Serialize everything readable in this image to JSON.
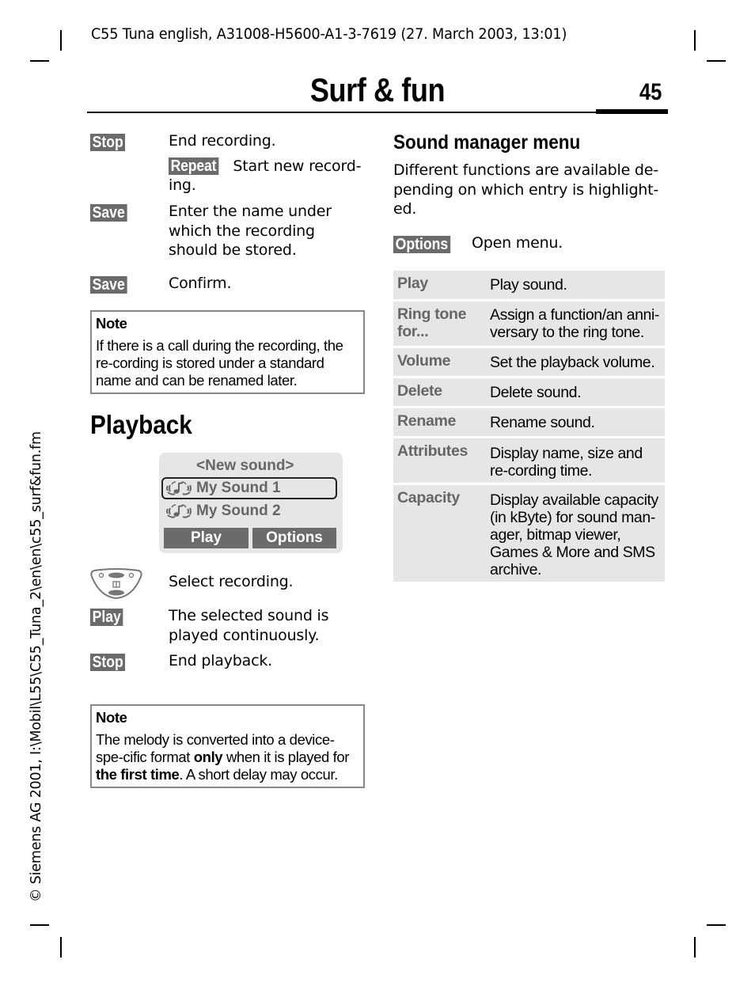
{
  "header": {
    "running_header": "C55 Tuna english, A31008-H5600-A1-3-7619 (27. March 2003, 13:01)",
    "chapter_title": "Surf & fun",
    "page_number": "45"
  },
  "left_column": {
    "recording_steps": [
      {
        "key": "Stop",
        "desc": "End recording.",
        "sub_key": "Repeat",
        "sub_desc": "Start new record-ing."
      },
      {
        "key": "Save",
        "desc": "Enter the name under which the recording should be stored."
      },
      {
        "key": "Save",
        "desc": "Confirm."
      }
    ],
    "note1": {
      "title": "Note",
      "body": "If there is a call during the recording, the re-cording is stored under a standard name and can be renamed later."
    },
    "playback_title": "Playback",
    "screen": {
      "items": [
        {
          "label": "<New sound>",
          "icon": "none"
        },
        {
          "label": "My Sound 1",
          "icon": "music-note-icon",
          "selected": true
        },
        {
          "label": "My Sound 2",
          "icon": "music-note-icon"
        }
      ],
      "softkey_left": "Play",
      "softkey_right": "Options"
    },
    "playback_steps": [
      {
        "key": "nav-key-icon",
        "desc": "Select recording."
      },
      {
        "key": "Play",
        "desc": "The selected sound is played continuously."
      },
      {
        "key": "Stop",
        "desc": "End playback."
      }
    ],
    "note2": {
      "title": "Note",
      "body_part1": "The melody is converted into a device-spe-cific format ",
      "bold1": "only",
      "body_part2": " when it is played for ",
      "bold2": "the first time",
      "body_part3": ". A short delay may occur."
    }
  },
  "right_column": {
    "title": "Sound manager menu",
    "intro": "Different functions are available de-pending on which entry is highlight-ed.",
    "options_key": "Options",
    "options_desc": "Open menu.",
    "menu": [
      {
        "name": "Play",
        "desc": "Play sound."
      },
      {
        "name": "Ring tone for...",
        "desc": "Assign a function/an anni-versary to the ring tone."
      },
      {
        "name": "Volume",
        "desc": "Set the playback volume."
      },
      {
        "name": "Delete",
        "desc": "Delete sound."
      },
      {
        "name": "Rename",
        "desc": "Rename sound."
      },
      {
        "name": "Attributes",
        "desc": "Display name, size and re-cording time."
      },
      {
        "name": "Capacity",
        "desc": "Display available capacity (in kByte) for sound man-ager, bitmap viewer, Games & More and SMS archive."
      }
    ]
  },
  "side_text": "© Siemens AG 2001, I:\\Mobil\\L55\\C55_Tuna_2\\en\\en\\c55_surf&fun.fm",
  "colors": {
    "key_bg": "#6b6b6b",
    "table_bg": "#e6e6e6",
    "menu_name": "#666666"
  }
}
